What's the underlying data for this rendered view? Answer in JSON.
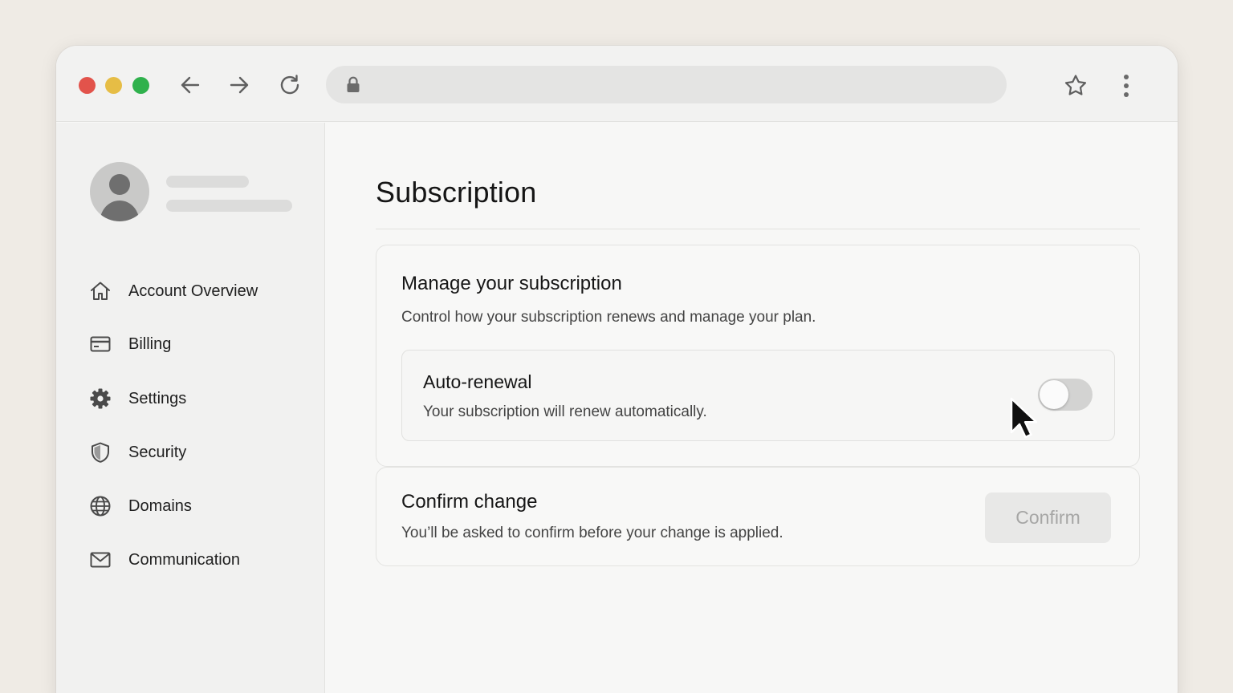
{
  "browser": {
    "address_value": "",
    "icons": [
      "back-arrow-icon",
      "forward-arrow-icon",
      "reload-icon",
      "lock-icon",
      "star-icon",
      "more-vertical-icon"
    ],
    "traffic_light_colors": [
      "#e2534b",
      "#e6bd45",
      "#2fb14c"
    ]
  },
  "sidebar": {
    "items": [
      {
        "label": "Account Overview",
        "icon": "home-icon"
      },
      {
        "label": "Billing",
        "icon": "credit-card-icon"
      },
      {
        "label": "Settings",
        "icon": "gear-icon"
      },
      {
        "label": "Security",
        "icon": "shield-icon"
      },
      {
        "label": "Domains",
        "icon": "globe-icon"
      },
      {
        "label": "Communication",
        "icon": "mail-icon"
      }
    ]
  },
  "main": {
    "title": "Subscription",
    "manage": {
      "heading": "Manage your subscription",
      "description": "Control how your subscription renews and manage your plan.",
      "auto_renewal": {
        "label": "Auto-renewal",
        "description": "Your subscription will renew automatically.",
        "enabled": false
      }
    },
    "confirm": {
      "heading": "Confirm change",
      "description": "You’ll be asked to confirm before your change is applied.",
      "button_label": "Confirm",
      "button_enabled": false
    }
  }
}
